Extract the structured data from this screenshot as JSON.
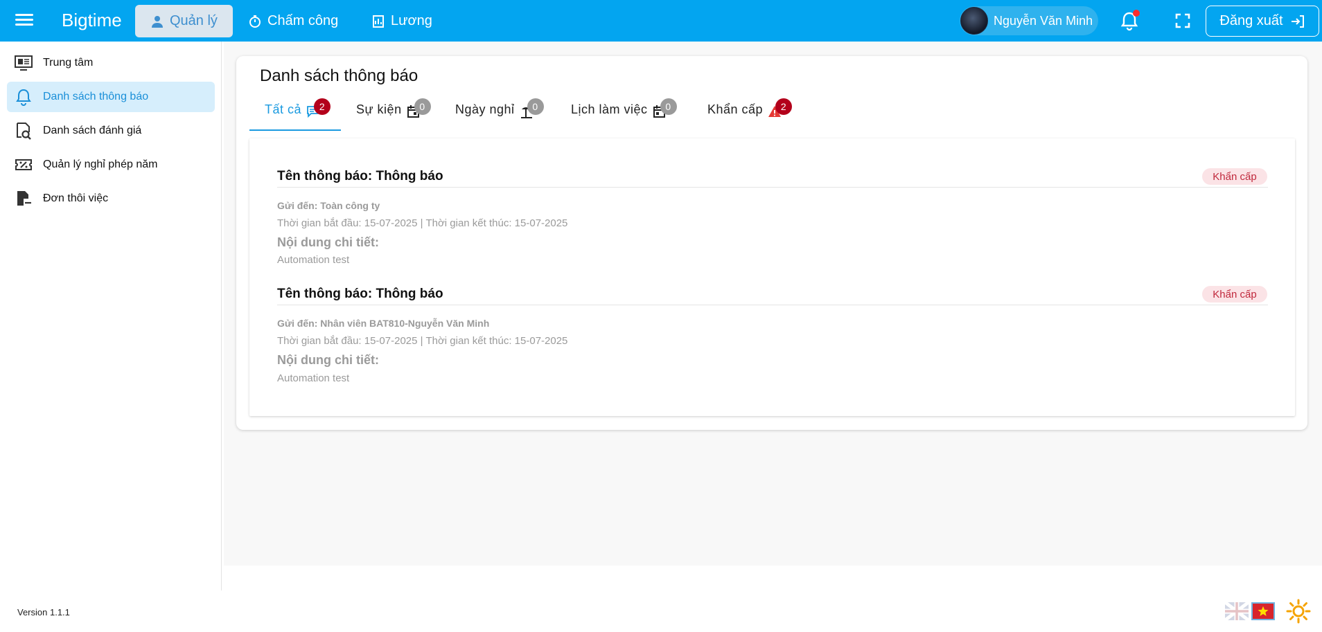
{
  "header": {
    "brand": "Bigtime",
    "nav": [
      {
        "label": "Quản lý",
        "icon": "manager-icon"
      },
      {
        "label": "Chấm công",
        "icon": "stopwatch-icon"
      },
      {
        "label": "Lương",
        "icon": "payroll-icon"
      }
    ],
    "user_name": "Nguyễn Văn Minh",
    "logout_label": "Đăng xuất"
  },
  "sidebar": {
    "items": [
      {
        "label": "Trung tâm",
        "icon": "dashboard-icon"
      },
      {
        "label": "Danh sách thông báo",
        "icon": "bell-icon"
      },
      {
        "label": "Danh sách đánh giá",
        "icon": "review-icon"
      },
      {
        "label": "Quản lý nghỉ phép năm",
        "icon": "ticket-icon"
      },
      {
        "label": "Đơn thôi việc",
        "icon": "resign-icon"
      }
    ]
  },
  "page": {
    "title": "Danh sách thông báo",
    "tabs": [
      {
        "label": "Tất cả",
        "count": "2"
      },
      {
        "label": "Sự kiện",
        "count": "0"
      },
      {
        "label": "Ngày nghỉ",
        "count": "0"
      },
      {
        "label": "Lịch làm việc",
        "count": "0"
      },
      {
        "label": "Khẩn cấp",
        "count": "2"
      }
    ]
  },
  "notifications": [
    {
      "title": "Tên thông báo: Thông báo",
      "badge": "Khẩn cấp",
      "sent_to": "Gửi đến: Toàn công ty",
      "times": "Thời gian bắt đầu: 15-07-2025 | Thời gian kết thúc: 15-07-2025",
      "detail_heading": "Nội dung chi tiết:",
      "detail": "Automation test"
    },
    {
      "title": "Tên thông báo: Thông báo",
      "badge": "Khẩn cấp",
      "sent_to": "Gửi đến: Nhân viên BAT810-Nguyễn Văn Minh",
      "times": "Thời gian bắt đầu: 15-07-2025 | Thời gian kết thúc: 15-07-2025",
      "detail_heading": "Nội dung chi tiết:",
      "detail": "Automation test"
    }
  ],
  "footer": {
    "version": "Version 1.1.1"
  },
  "colors": {
    "primary": "#03a5f0",
    "accent": "#1a9ae0",
    "urgent": "#b3001b"
  }
}
